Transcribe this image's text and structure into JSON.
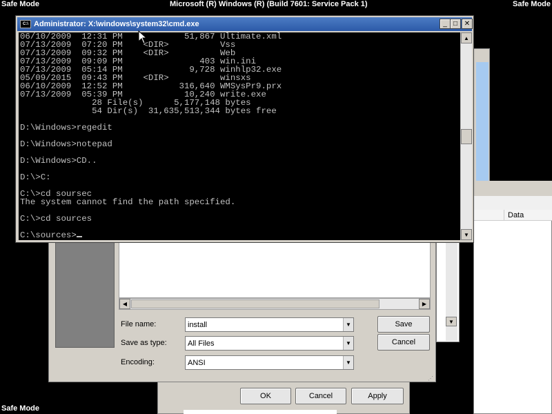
{
  "screen": {
    "corner_labels": {
      "top_left": "Safe Mode",
      "top_right": "Safe Mode",
      "bottom_left": "Safe Mode"
    },
    "top_title": "Microsoft (R) Windows (R) (Build 7601: Service Pack 1)"
  },
  "cmd": {
    "title": "Administrator: X:\\windows\\system32\\cmd.exe",
    "icon_text": "C:\\",
    "lines": [
      "06/10/2009  12:31 PM            51,867 Ultimate.xml",
      "07/13/2009  07:20 PM    <DIR>          Vss",
      "07/13/2009  09:32 PM    <DIR>          Web",
      "07/13/2009  09:09 PM               403 win.ini",
      "07/13/2009  05:14 PM             9,728 winhlp32.exe",
      "05/09/2015  09:43 PM    <DIR>          winsxs",
      "06/10/2009  12:52 PM           316,640 WMSysPr9.prx",
      "07/13/2009  05:39 PM            10,240 write.exe",
      "              28 File(s)      5,177,148 bytes",
      "              54 Dir(s)  31,635,513,344 bytes free",
      "",
      "D:\\Windows>regedit",
      "",
      "D:\\Windows>notepad",
      "",
      "D:\\Windows>CD..",
      "",
      "D:\\>C:",
      "",
      "C:\\>cd soursec",
      "The system cannot find the path specified.",
      "",
      "C:\\>cd sources",
      "",
      "C:\\sources>"
    ],
    "buttons": {
      "minimize": "_",
      "maximize": "□",
      "close": "✕"
    }
  },
  "regedit": {
    "column_data": "Data"
  },
  "save_dialog": {
    "file_name_label": "File name:",
    "file_name_value": "install",
    "save_as_type_label": "Save as type:",
    "save_as_type_value": "All Files",
    "encoding_label": "Encoding:",
    "encoding_value": "ANSI",
    "save_button": "Save",
    "cancel_button": "Cancel"
  },
  "properties_dialog": {
    "ok_button": "OK",
    "cancel_button": "Cancel",
    "apply_button": "Apply"
  }
}
